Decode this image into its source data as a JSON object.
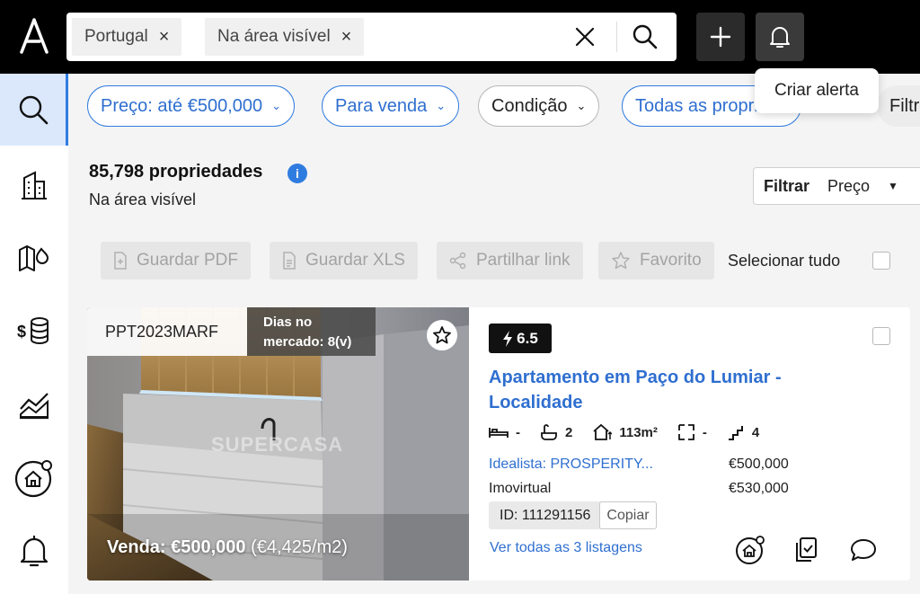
{
  "search": {
    "chips": [
      "Portugal",
      "Na área visível"
    ],
    "chip_close_glyph": "×"
  },
  "tooltip": {
    "label": "Criar alerta"
  },
  "filters": {
    "pills": [
      "Preço: até €500,000",
      "Para venda",
      "Condição",
      "Todas as propriedades"
    ],
    "overflow_label": "Filtr"
  },
  "results": {
    "count": "85,798 propriedades",
    "info_glyph": "i",
    "area": "Na área visível",
    "sort_label": "Filtrar",
    "sort_value": "Preço",
    "sort_caret": "▼"
  },
  "actions": {
    "save_pdf": "Guardar PDF",
    "save_xls": "Guardar XLS",
    "share": "Partilhar link",
    "favorite": "Favorito",
    "select_all": "Selecionar tudo"
  },
  "listing": {
    "ref": "PPT2023MARF",
    "days_line1": "Dias no",
    "days_line2": "mercado: 8(v)",
    "watermark": "SUPERCASA",
    "sale_label": "Venda: €500,000",
    "price_per_m2": "(€4,425/m2)",
    "score": "6.5",
    "title": "Apartamento em Paço do Lumiar - Localidade",
    "features": {
      "beds": "-",
      "baths": "2",
      "area": "113m²",
      "lot": "-",
      "floors": "4"
    },
    "sources": [
      {
        "name": "Idealista: PROSPERITY...",
        "price": "€500,000"
      },
      {
        "name": "Imovirtual",
        "price": "€530,000"
      }
    ],
    "id": "ID: 111291156",
    "copy": "Copiar",
    "see_all": "Ver todas as 3 listagens"
  },
  "colors": {
    "accent": "#2f7ce0",
    "link": "#2f6fd0",
    "topbar": "#000000"
  }
}
